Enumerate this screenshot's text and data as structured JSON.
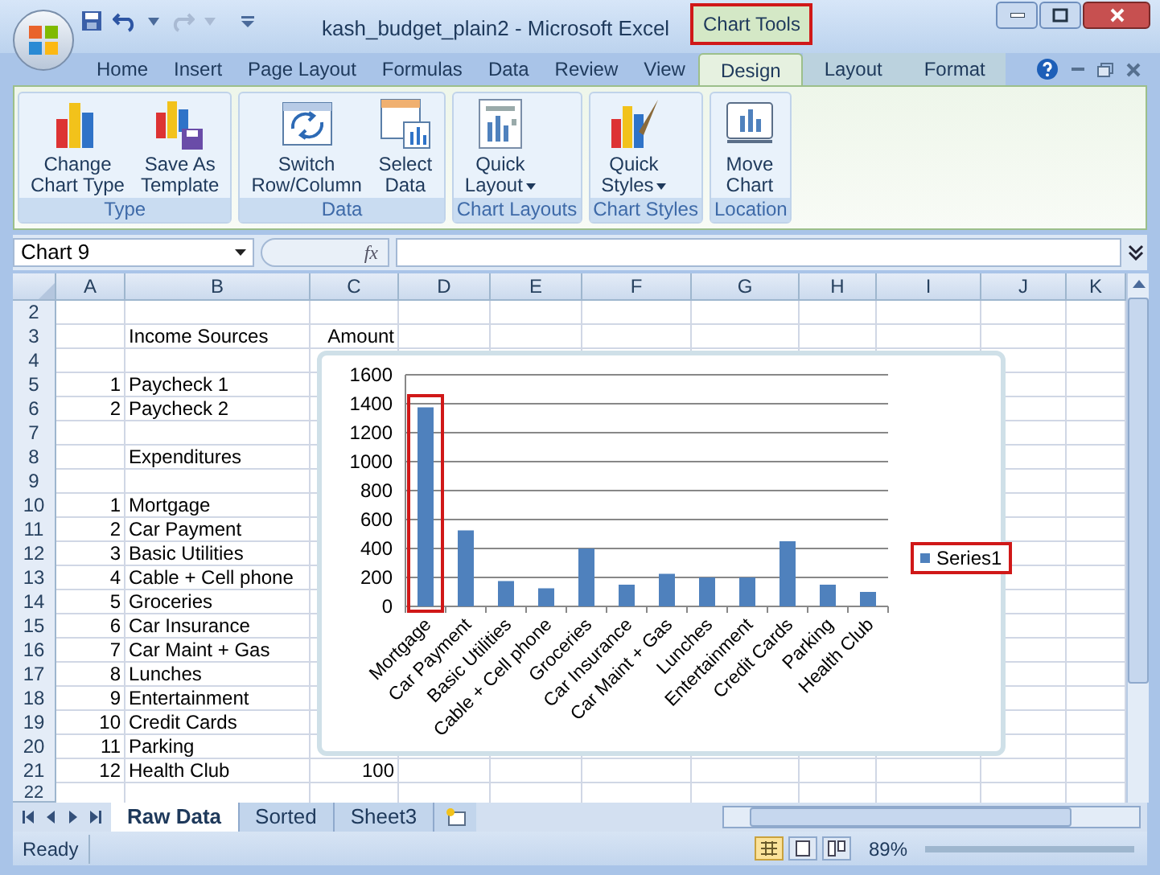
{
  "window": {
    "title": "kash_budget_plain2 - Microsoft Excel",
    "context_tab": {
      "label": "Chart Tools",
      "highlighted": true
    }
  },
  "ribbon_tabs": [
    {
      "label": "Home",
      "selected": false,
      "contextual": false
    },
    {
      "label": "Insert",
      "selected": false,
      "contextual": false
    },
    {
      "label": "Page Layout",
      "selected": false,
      "contextual": false
    },
    {
      "label": "Formulas",
      "selected": false,
      "contextual": false
    },
    {
      "label": "Data",
      "selected": false,
      "contextual": false
    },
    {
      "label": "Review",
      "selected": false,
      "contextual": false
    },
    {
      "label": "View",
      "selected": false,
      "contextual": false
    },
    {
      "label": "Design",
      "selected": true,
      "contextual": true
    },
    {
      "label": "Layout",
      "selected": false,
      "contextual": true
    },
    {
      "label": "Format",
      "selected": false,
      "contextual": true
    }
  ],
  "ribbon_groups": [
    {
      "label": "Type",
      "buttons": [
        {
          "kind": "chart-type",
          "lines": [
            "Change",
            "Chart Type"
          ],
          "dropdown": false
        },
        {
          "kind": "template",
          "lines": [
            "Save As",
            "Template"
          ],
          "dropdown": false
        }
      ]
    },
    {
      "label": "Data",
      "buttons": [
        {
          "kind": "switch",
          "lines": [
            "Switch",
            "Row/Column"
          ],
          "dropdown": false
        },
        {
          "kind": "select",
          "lines": [
            "Select",
            "Data"
          ],
          "dropdown": false
        }
      ]
    },
    {
      "label": "Chart Layouts",
      "buttons": [
        {
          "kind": "layout",
          "lines": [
            "Quick",
            "Layout"
          ],
          "dropdown": true
        }
      ]
    },
    {
      "label": "Chart Styles",
      "buttons": [
        {
          "kind": "styles",
          "lines": [
            "Quick",
            "Styles"
          ],
          "dropdown": true
        }
      ]
    },
    {
      "label": "Location",
      "buttons": [
        {
          "kind": "move",
          "lines": [
            "Move",
            "Chart"
          ],
          "dropdown": false
        }
      ]
    }
  ],
  "formula_bar": {
    "name_box": "Chart 9",
    "fx": "fx"
  },
  "sheet": {
    "columns": [
      "A",
      "B",
      "C",
      "D",
      "E",
      "F",
      "G",
      "H",
      "I",
      "J",
      "K"
    ],
    "rows": [
      {
        "number": "2",
        "cells": {}
      },
      {
        "number": "3",
        "cells": {
          "B": "Income Sources",
          "C": "Amount"
        }
      },
      {
        "number": "4",
        "cells": {}
      },
      {
        "number": "5",
        "cells": {
          "A": "1",
          "B": "Paycheck 1"
        }
      },
      {
        "number": "6",
        "cells": {
          "A": "2",
          "B": "Paycheck 2"
        }
      },
      {
        "number": "7",
        "cells": {}
      },
      {
        "number": "8",
        "cells": {
          "B": "Expenditures"
        }
      },
      {
        "number": "9",
        "cells": {}
      },
      {
        "number": "10",
        "cells": {
          "A": "1",
          "B": "Mortgage"
        }
      },
      {
        "number": "11",
        "cells": {
          "A": "2",
          "B": "Car Payment"
        }
      },
      {
        "number": "12",
        "cells": {
          "A": "3",
          "B": "Basic Utilities"
        }
      },
      {
        "number": "13",
        "cells": {
          "A": "4",
          "B": "Cable + Cell phone"
        }
      },
      {
        "number": "14",
        "cells": {
          "A": "5",
          "B": "Groceries"
        }
      },
      {
        "number": "15",
        "cells": {
          "A": "6",
          "B": "Car Insurance"
        }
      },
      {
        "number": "16",
        "cells": {
          "A": "7",
          "B": "Car Maint + Gas"
        }
      },
      {
        "number": "17",
        "cells": {
          "A": "8",
          "B": "Lunches"
        }
      },
      {
        "number": "18",
        "cells": {
          "A": "9",
          "B": "Entertainment"
        }
      },
      {
        "number": "19",
        "cells": {
          "A": "10",
          "B": "Credit Cards"
        }
      },
      {
        "number": "20",
        "cells": {
          "A": "11",
          "B": "Parking"
        }
      },
      {
        "number": "21",
        "cells": {
          "A": "12",
          "B": "Health Club",
          "C": "100"
        }
      },
      {
        "number": "22",
        "cells": {}
      }
    ]
  },
  "chart": {
    "legend_highlighted": true,
    "chart_data": {
      "type": "bar",
      "categories": [
        "Mortgage",
        "Car Payment",
        "Basic Utilities",
        "Cable + Cell phone",
        "Groceries",
        "Car Insurance",
        "Car Maint + Gas",
        "Lunches",
        "Entertainment",
        "Credit Cards",
        "Parking",
        "Health Club"
      ],
      "series": [
        {
          "name": "Series1",
          "color": "#4f81bd",
          "values": [
            1375,
            525,
            175,
            125,
            400,
            150,
            225,
            200,
            200,
            450,
            150,
            100
          ]
        }
      ],
      "ylim": [
        0,
        1600
      ],
      "yticks": [
        0,
        200,
        400,
        600,
        800,
        1000,
        1200,
        1400,
        1600
      ],
      "grid": true
    },
    "highlighted_bars": [
      true,
      false,
      false,
      false,
      false,
      false,
      false,
      false,
      false,
      false,
      false,
      false
    ]
  },
  "sheet_tabs": [
    {
      "label": "Raw Data",
      "selected": true
    },
    {
      "label": "Sorted",
      "selected": false
    },
    {
      "label": "Sheet3",
      "selected": false
    }
  ],
  "status_bar": {
    "status": "Ready",
    "zoom": "89%"
  }
}
